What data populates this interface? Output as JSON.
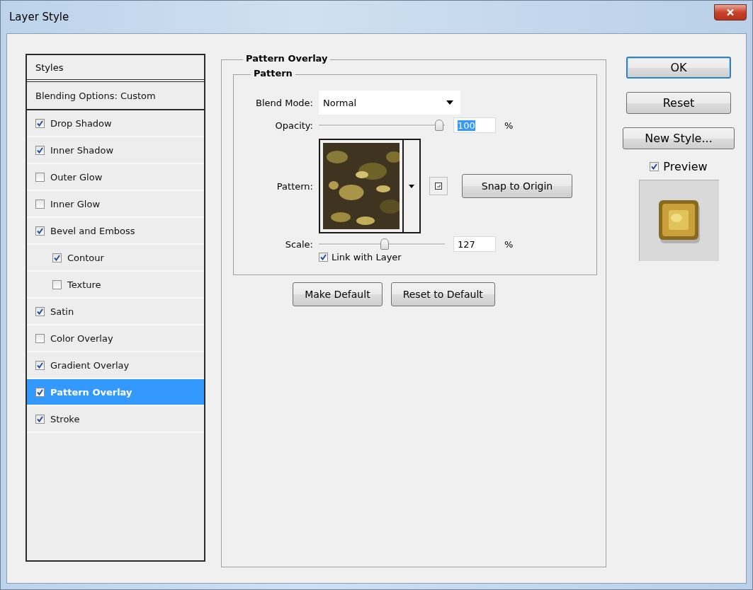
{
  "window": {
    "title": "Layer Style"
  },
  "styles_panel": {
    "header": "Styles",
    "items": [
      {
        "kind": "header",
        "label": "Blending Options: Custom",
        "selected": false
      },
      {
        "kind": "checkbox",
        "label": "Drop Shadow",
        "checked": true,
        "selected": false
      },
      {
        "kind": "checkbox",
        "label": "Inner Shadow",
        "checked": true,
        "selected": false
      },
      {
        "kind": "checkbox",
        "label": "Outer Glow",
        "checked": false,
        "selected": false
      },
      {
        "kind": "checkbox",
        "label": "Inner Glow",
        "checked": false,
        "selected": false
      },
      {
        "kind": "checkbox",
        "label": "Bevel and Emboss",
        "checked": true,
        "selected": false,
        "children": [
          {
            "kind": "checkbox",
            "label": "Contour",
            "checked": true,
            "selected": false
          },
          {
            "kind": "checkbox",
            "label": "Texture",
            "checked": false,
            "selected": false
          }
        ]
      },
      {
        "kind": "checkbox",
        "label": "Satin",
        "checked": true,
        "selected": false
      },
      {
        "kind": "checkbox",
        "label": "Color Overlay",
        "checked": false,
        "selected": false
      },
      {
        "kind": "checkbox",
        "label": "Gradient Overlay",
        "checked": true,
        "selected": false
      },
      {
        "kind": "checkbox",
        "label": "Pattern Overlay",
        "checked": true,
        "selected": true
      },
      {
        "kind": "checkbox",
        "label": "Stroke",
        "checked": true,
        "selected": false
      }
    ]
  },
  "settings": {
    "title": "Pattern Overlay",
    "group": {
      "title": "Pattern",
      "blend_mode": {
        "label": "Blend Mode:",
        "value": "Normal"
      },
      "opacity": {
        "label": "Opacity:",
        "level": 1.0,
        "value": "100",
        "text_selected": true,
        "unit": "%"
      },
      "pattern": {
        "label": "Pattern:",
        "snap_button": "Snap to Origin"
      },
      "scale": {
        "label": "Scale:",
        "level": 0.53,
        "value": "127",
        "unit": "%"
      },
      "link_with_layer": {
        "label": "Link with Layer",
        "checked": true
      }
    },
    "buttons": [
      "Make Default",
      "Reset to Default"
    ]
  },
  "actions": {
    "buttons": [
      {
        "label": "OK",
        "default": true
      },
      {
        "label": "Reset",
        "default": false
      },
      {
        "label": "New Style...",
        "default": false
      }
    ],
    "preview": {
      "label": "Preview",
      "checked": true
    }
  }
}
